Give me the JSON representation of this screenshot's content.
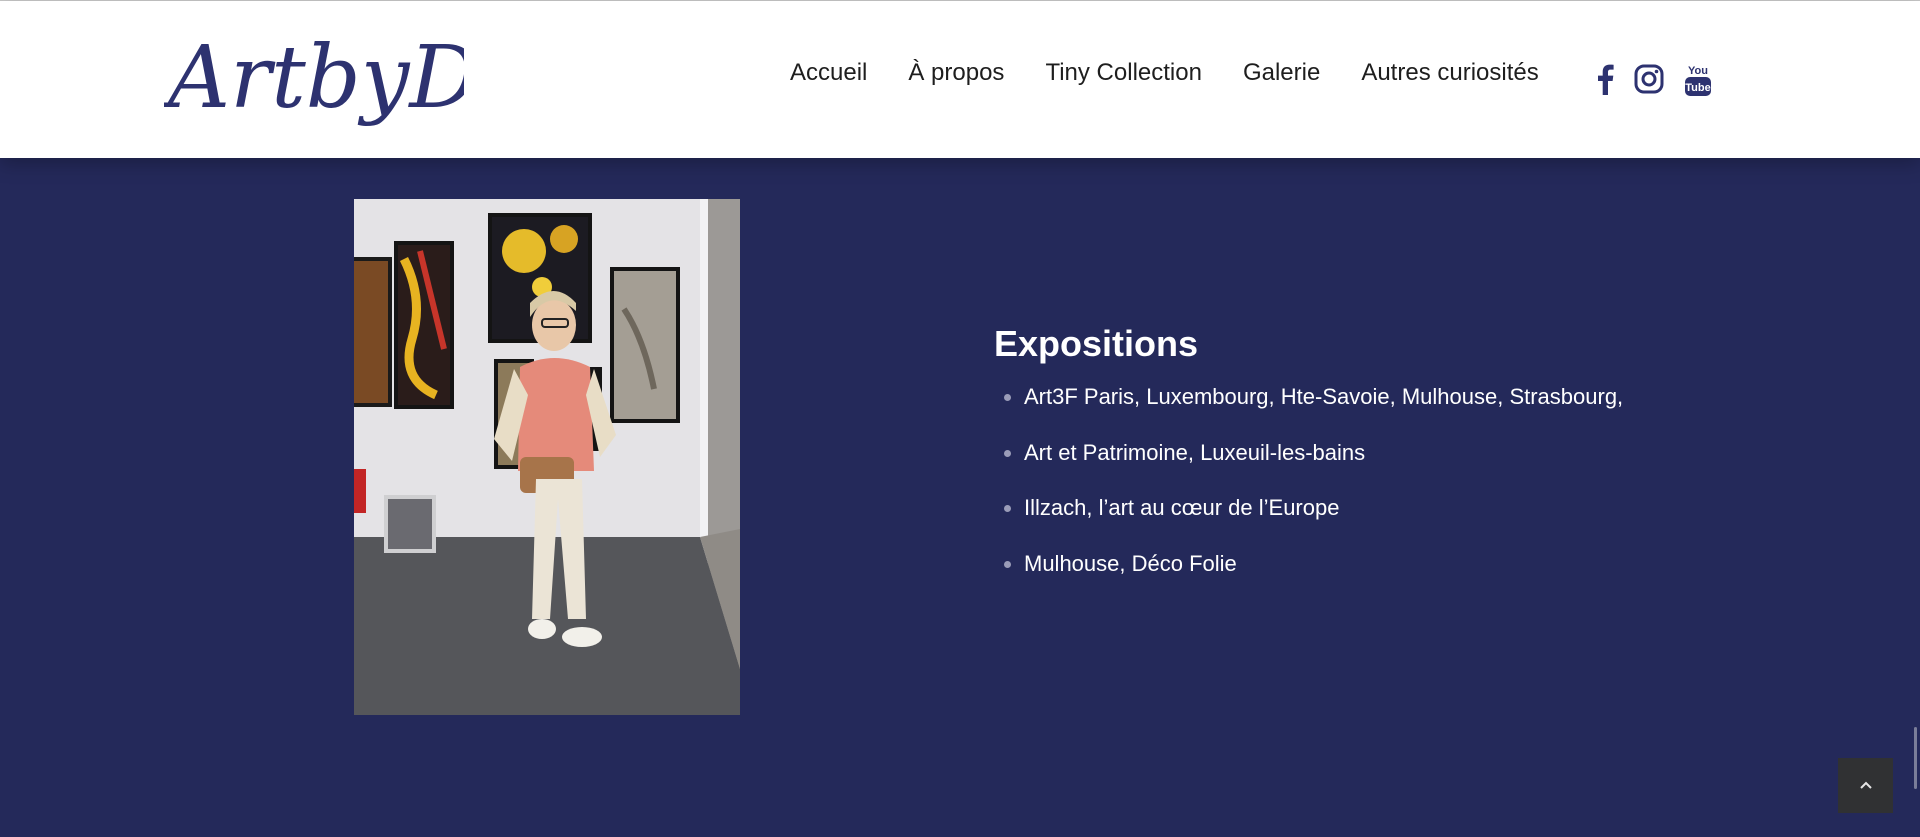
{
  "brand": {
    "logo_text": "ArtbyDo",
    "color": "#2d3270"
  },
  "nav": {
    "items": [
      {
        "label": "Accueil"
      },
      {
        "label": "À propos"
      },
      {
        "label": "Tiny Collection"
      },
      {
        "label": "Galerie"
      },
      {
        "label": "Autres curiosités"
      }
    ]
  },
  "social": {
    "icons": [
      "facebook-icon",
      "instagram-icon",
      "youtube-icon"
    ],
    "youtube_text_top": "You",
    "youtube_text_bottom": "Tube"
  },
  "expositions": {
    "title": "Expositions",
    "items": [
      {
        "label": "Art3F Paris, Luxembourg, Hte-Savoie, Mulhouse, Strasbourg,"
      },
      {
        "label": "Art et Patrimoine, Luxeuil-les-bains"
      },
      {
        "label": "Illzach, l’art au cœur de l’Europe"
      },
      {
        "label": "Mulhouse, Déco Folie"
      }
    ]
  },
  "colors": {
    "page_background": "#24295a",
    "header_background": "#ffffff",
    "text_light": "#ffffff",
    "bullet": "#9a9cb8",
    "to_top_button": "#303133"
  },
  "back_to_top_icon": "chevron-up-icon"
}
